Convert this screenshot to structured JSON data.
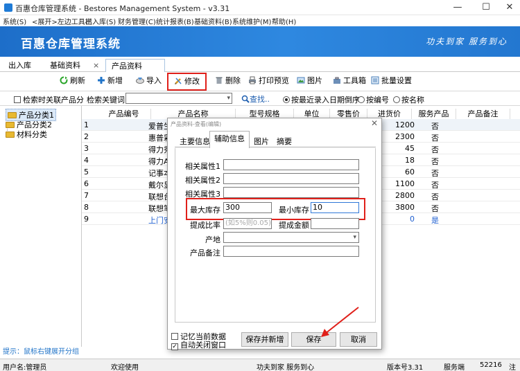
{
  "window": {
    "title": "百惠仓库管理系统 - Bestores Management System - v3.31",
    "controls": {
      "minimize": "—",
      "maximize": "☐",
      "close": "✕"
    }
  },
  "menubar": [
    "系统(S)",
    "<展开>左边工具栏",
    "出入库(S)",
    "财务管理(C)",
    "统计报表(B)",
    "基础资料(B)",
    "系统维护(M)",
    "帮助(H)"
  ],
  "banner": {
    "app_title": "百惠仓库管理系统",
    "slogan": "功夫到家  服务到心"
  },
  "tabs": [
    {
      "label": "出入库"
    },
    {
      "label": "基础资料"
    },
    {
      "label": "×"
    },
    {
      "label": "产品资料"
    }
  ],
  "toolbar": {
    "refresh": "刷新",
    "add": "新增",
    "import": "导入",
    "edit": "修改",
    "delete": "删除",
    "print_preview": "打印预览",
    "image": "图片",
    "toolbox": "工具箱",
    "batch_settings": "批量设置"
  },
  "search": {
    "related_category_label": "检索时关联产品分",
    "keyword_label": "检索关键词",
    "keyword_value": "",
    "search_button": "查找..",
    "sort_by_date": "按最近录入日期倒序",
    "sort_by_code": "按编号",
    "sort_by_name": "按名称"
  },
  "tree": {
    "nodes": [
      "产品分类1",
      "产品分类2",
      "材料分类"
    ],
    "hint": "提示：鼠标右键展开分组"
  },
  "grid": {
    "columns": [
      "产品编号",
      "产品名称",
      "型号规格",
      "单位",
      "零售价",
      "进货价",
      "服务产品",
      "产品备注"
    ],
    "rows": [
      {
        "no": "1",
        "name": "爱普生",
        "cost": "1200",
        "service": "否"
      },
      {
        "no": "2",
        "name": "惠普彩",
        "cost": "2300",
        "service": "否"
      },
      {
        "no": "3",
        "name": "得力秀",
        "cost": "45",
        "service": "否"
      },
      {
        "no": "4",
        "name": "得力A",
        "cost": "18",
        "service": "否"
      },
      {
        "no": "5",
        "name": "记事本",
        "cost": "60",
        "service": "否"
      },
      {
        "no": "6",
        "name": "戴尔显",
        "cost": "1100",
        "service": "否"
      },
      {
        "no": "7",
        "name": "联想台",
        "cost": "2800",
        "service": "否"
      },
      {
        "no": "8",
        "name": "联想笔",
        "cost": "3800",
        "service": "否"
      },
      {
        "no": "9",
        "name": "上门安",
        "cost": "0",
        "service": "是"
      }
    ]
  },
  "dialog": {
    "title": "产品资料-查看(编辑)",
    "close": "✕",
    "tabs": [
      "主要信息",
      "辅助信息",
      "图片",
      "摘要"
    ],
    "fields": {
      "attr1_label": "相关属性1",
      "attr2_label": "相关属性2",
      "attr3_label": "相关属性3",
      "max_stock_label": "最大库存",
      "max_stock_value": "300",
      "min_stock_label": "最小库存",
      "min_stock_value": "10",
      "commission_rate_label": "提成比率",
      "commission_rate_placeholder": "(如5%则0.05)",
      "commission_amount_label": "提成金额",
      "origin_label": "产地",
      "remark_label": "产品备注"
    },
    "remember_label": "记忆当前数据",
    "auto_close_label": "自动关闭窗口",
    "save_new_button": "保存并新增",
    "save_button": "保存",
    "cancel_button": "取消"
  },
  "status": {
    "user": "用户名:管理员",
    "welcome": "欢迎使用",
    "motto": "功夫到家 服务到心",
    "version": "版本号3.31",
    "server": "服务端",
    "port": "52216",
    "tail": "注"
  },
  "colors": {
    "banner": "#1d6ec9",
    "highlight_red": "#e0201a",
    "link_blue": "#1f73c8",
    "annotation_arrow": "#e0201a"
  }
}
